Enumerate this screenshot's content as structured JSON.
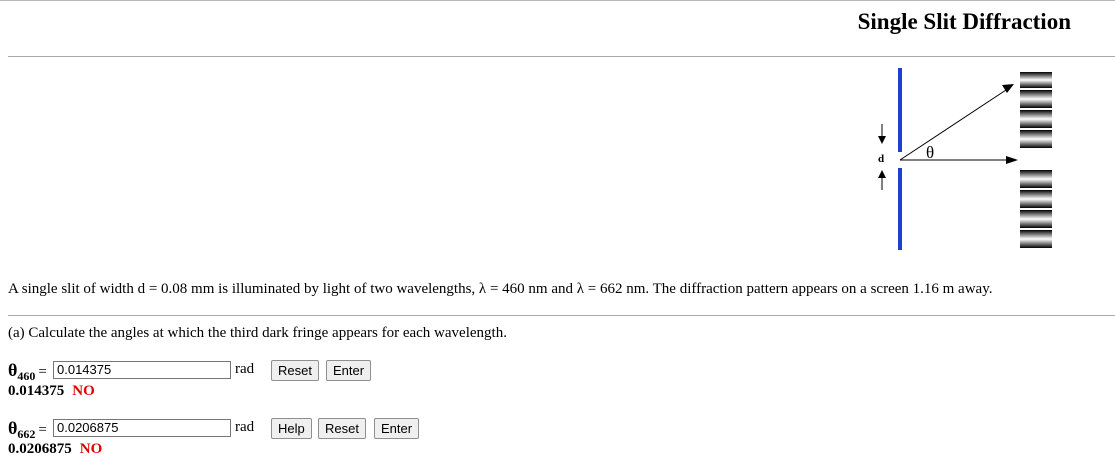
{
  "page": {
    "title": "Single Slit Diffraction"
  },
  "diagram": {
    "slit_label": "d",
    "angle_label": "θ",
    "slit_color": "#1f3fcf"
  },
  "problem_text": "A single slit of width d = 0.08 mm is illuminated by light of two wavelengths, λ = 460 nm and λ = 662 nm. The diffraction pattern appears on a screen 1.16 m away.",
  "part_a": {
    "question": "(a) Calculate the angles at which the third dark fringe appears for each wavelength.",
    "rows": [
      {
        "symbol": "θ",
        "subscript": "460",
        "equals": "=",
        "input_value": "0.014375",
        "unit": "rad",
        "buttons": [
          "Reset",
          "Enter"
        ],
        "submitted_value": "0.014375",
        "verdict": "NO",
        "verdict_color": "#e00000"
      },
      {
        "symbol": "θ",
        "subscript": "662",
        "equals": "=",
        "input_value": "0.0206875",
        "unit": "rad",
        "buttons": [
          "Help",
          "Reset",
          "Enter"
        ],
        "submitted_value": "0.0206875",
        "verdict": "NO",
        "verdict_color": "#e00000"
      }
    ]
  }
}
